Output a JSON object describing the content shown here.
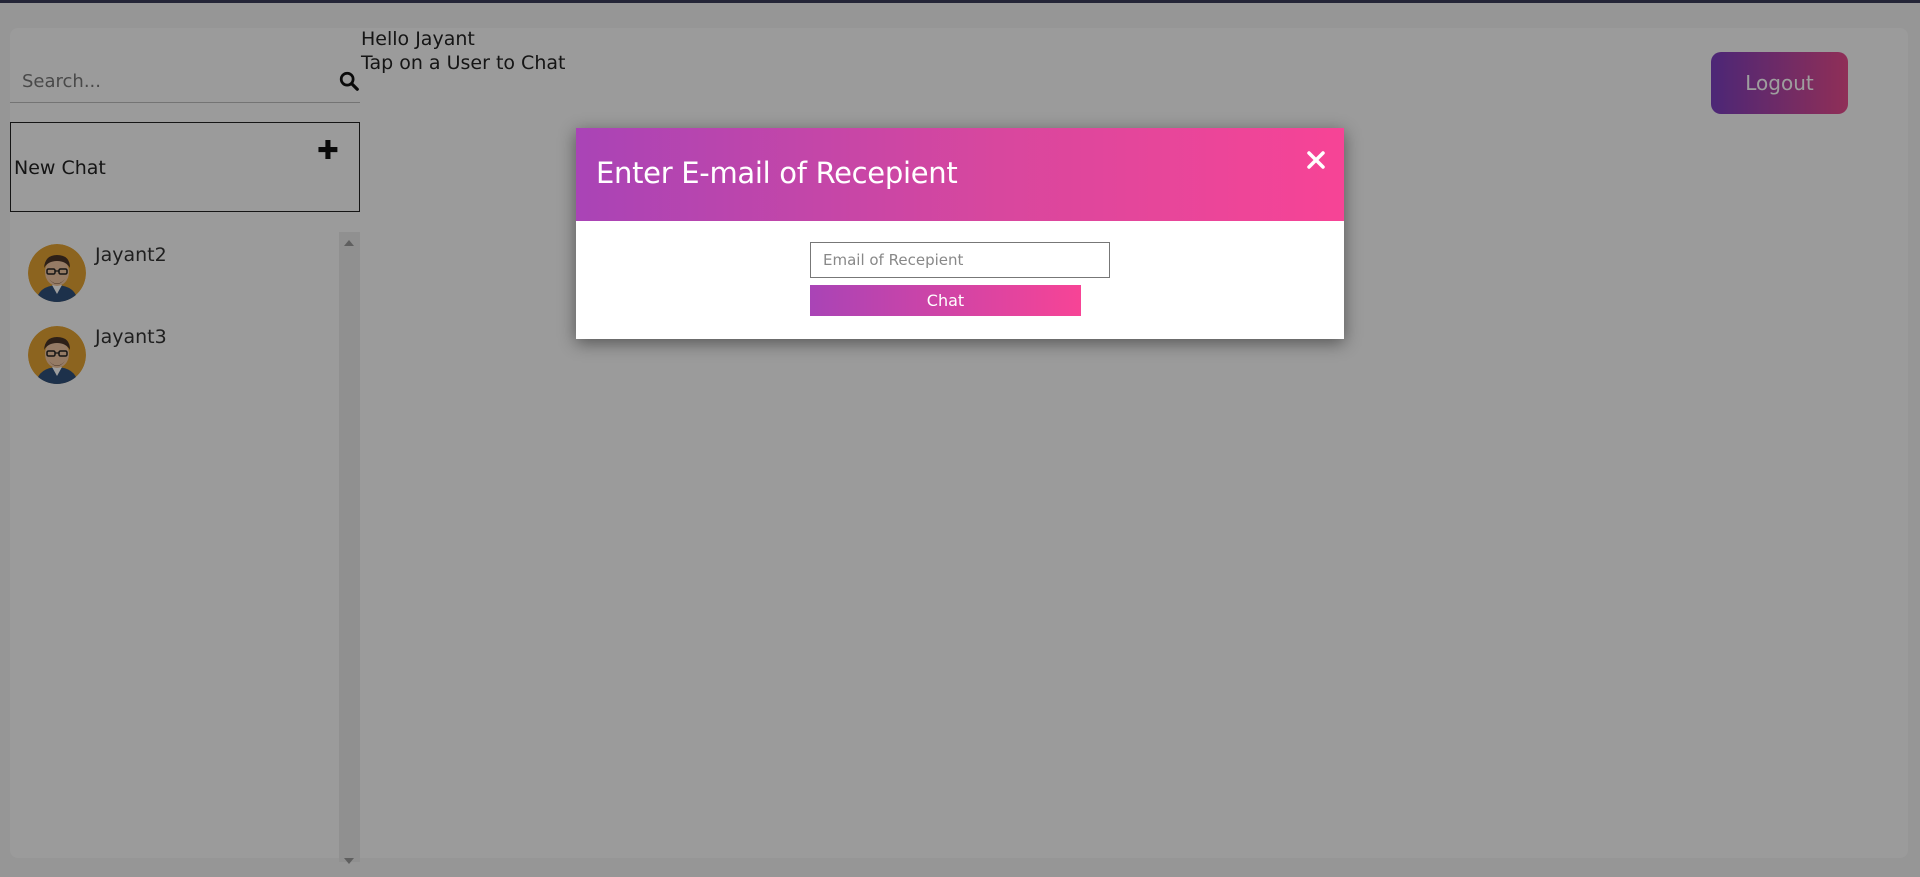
{
  "sidebar": {
    "search": {
      "placeholder": "Search..."
    },
    "new_chat": {
      "label": "New Chat"
    },
    "users": [
      {
        "name": "Jayant2"
      },
      {
        "name": "Jayant3"
      }
    ]
  },
  "header": {
    "greeting": "Hello Jayant",
    "hint": "Tap on a User to Chat",
    "logout_label": "Logout"
  },
  "modal": {
    "title": "Enter E-mail of Recepient",
    "email_placeholder": "Email of Recepient",
    "chat_label": "Chat"
  },
  "colors": {
    "gradient_start": "#a944b6",
    "gradient_end": "#f74496",
    "logout_start": "#7b3fbf",
    "logout_end": "#e84c8d"
  }
}
